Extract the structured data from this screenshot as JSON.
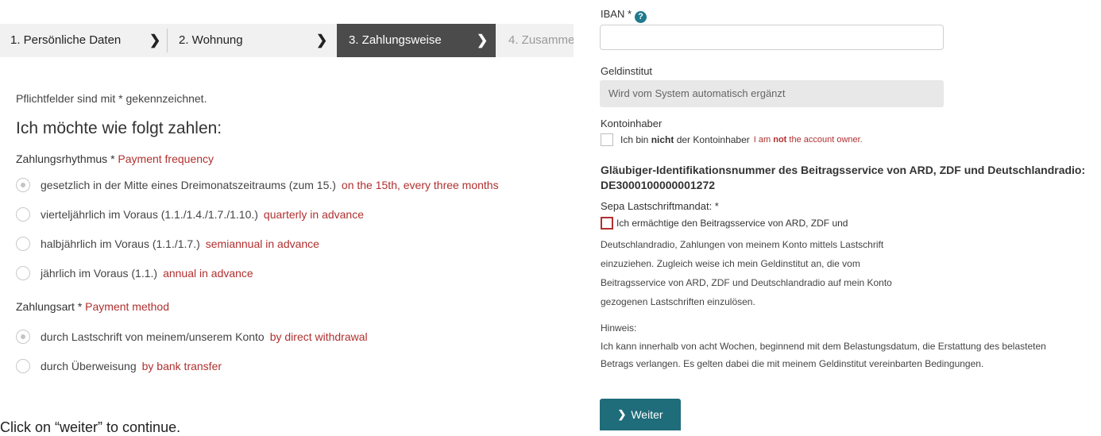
{
  "stepper": {
    "steps": [
      {
        "label": "1. Persönliche Daten"
      },
      {
        "label": "2. Wohnung"
      },
      {
        "label": "3. Zahlungsweise"
      },
      {
        "label": "4. Zusamme"
      }
    ],
    "active_index": 2
  },
  "form": {
    "required_note": "Pflichtfelder sind mit * gekennzeichnet.",
    "heading": "Ich möchte wie folgt zahlen:",
    "frequency": {
      "label": "Zahlungsrhythmus",
      "asterisk": "*",
      "annotation": "Payment frequency",
      "options": [
        {
          "label": "gesetzlich in der Mitte eines Dreimonatszeitraums (zum 15.)",
          "annotation": "on the 15th, every three months",
          "selected": true
        },
        {
          "label": "vierteljährlich im Voraus (1.1./1.4./1.7./1.10.)",
          "annotation": "quarterly in advance",
          "selected": false
        },
        {
          "label": "halbjährlich im Voraus (1.1./1.7.)",
          "annotation": "semiannual in advance",
          "selected": false
        },
        {
          "label": "jährlich im Voraus (1.1.)",
          "annotation": "annual in advance",
          "selected": false
        }
      ]
    },
    "method": {
      "label": "Zahlungsart",
      "asterisk": "*",
      "annotation": "Payment method",
      "options": [
        {
          "label": "durch Lastschrift von meinem/unserem Konto",
          "annotation": "by direct withdrawal",
          "selected": true
        },
        {
          "label": "durch Überweisung",
          "annotation": "by bank transfer",
          "selected": false
        }
      ]
    },
    "bottom_instruction": "Click on “weiter” to continue."
  },
  "bank": {
    "iban_label": "IBAN *",
    "help_icon": "?",
    "iban_value": "",
    "institute_label": "Geldinstitut",
    "institute_placeholder": "Wird vom System automatisch ergänzt",
    "owner_label": "Kontoinhaber",
    "owner_check": {
      "pre": "Ich bin ",
      "bold": "nicht",
      "post": " der Kontoinhaber",
      "annotation_pre": "I am ",
      "annotation_bold": "not",
      "annotation_post": " the account owner."
    },
    "creditor_line1": "Gläubiger-Identifikationsnummer des Beitragsservice von ARD, ZDF und Deutschlandradio:",
    "creditor_line2": "DE3000100000001272",
    "sepa_label": "Sepa Lastschriftmandat: *",
    "sepa_lines": [
      "Ich ermächtige den Beitragsservice von ARD, ZDF und",
      "Deutschlandradio, Zahlungen von meinem Konto mittels Lastschrift",
      "einzuziehen. Zugleich weise ich mein Geldinstitut an, die vom",
      "Beitragsservice von ARD, ZDF und Deutschlandradio auf mein Konto",
      "gezogenen Lastschriften einzulösen."
    ],
    "hint_label": "Hinweis:",
    "hint_lines": [
      "Ich kann innerhalb von acht Wochen, beginnend mit dem Belastungsdatum, die Erstattung des belasteten",
      "Betrags verlangen. Es gelten dabei die mit meinem Geldinstitut vereinbarten Bedingungen."
    ],
    "next_button": "Weiter"
  },
  "colors": {
    "annotation_red": "#b0302f",
    "active_step": "#4b4b4b",
    "button_teal": "#1f6c7a",
    "help_teal": "#1f7a8c"
  }
}
